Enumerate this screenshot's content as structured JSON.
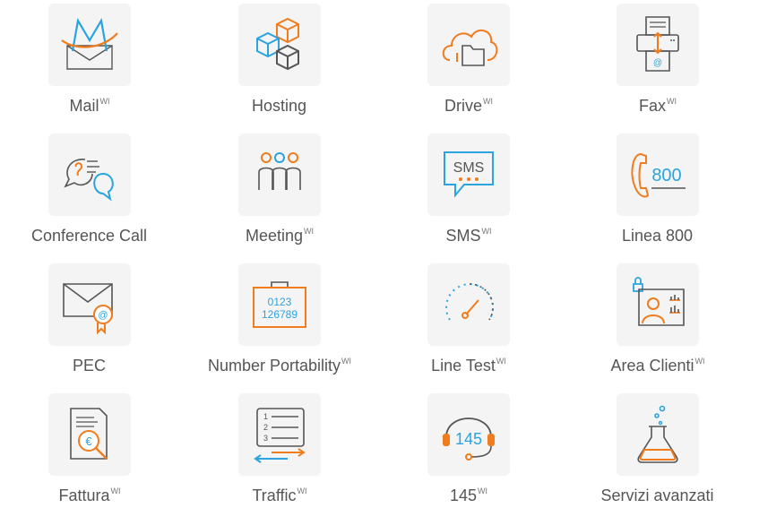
{
  "colors": {
    "orange": "#f07c1d",
    "blue": "#2aa3de",
    "grey": "#555555",
    "tile_bg": "#f4f4f4"
  },
  "tiles": [
    {
      "label": "Mail",
      "sup": "WI",
      "icon": "mail-icon"
    },
    {
      "label": "Hosting",
      "sup": "",
      "icon": "hosting-cubes-icon"
    },
    {
      "label": "Drive",
      "sup": "WI",
      "icon": "cloud-drive-icon"
    },
    {
      "label": "Fax",
      "sup": "WI",
      "icon": "fax-icon"
    },
    {
      "label": "Conference Call",
      "sup": "",
      "icon": "conference-call-icon"
    },
    {
      "label": "Meeting",
      "sup": "WI",
      "icon": "meeting-people-icon"
    },
    {
      "label": "SMS",
      "sup": "WI",
      "icon": "sms-bubble-icon"
    },
    {
      "label": "Linea 800",
      "sup": "",
      "icon": "phone-800-icon"
    },
    {
      "label": "PEC",
      "sup": "",
      "icon": "pec-certified-mail-icon"
    },
    {
      "label": "Number Portability",
      "sup": "WI",
      "icon": "number-portability-icon"
    },
    {
      "label": "Line Test",
      "sup": "WI",
      "icon": "speedometer-icon"
    },
    {
      "label": "Area Clienti",
      "sup": "WI",
      "icon": "customer-area-icon"
    },
    {
      "label": "Fattura",
      "sup": "WI",
      "icon": "invoice-search-icon"
    },
    {
      "label": "Traffic",
      "sup": "WI",
      "icon": "traffic-list-icon"
    },
    {
      "label": "145",
      "sup": "WI",
      "icon": "headset-145-icon"
    },
    {
      "label": "Servizi avanzati",
      "sup": "",
      "icon": "lab-flask-icon"
    }
  ],
  "icon_text": {
    "sms": "SMS",
    "linea800": "800",
    "portability_line1": "0123",
    "portability_line2": "126789",
    "traffic_1": "1",
    "traffic_2": "2",
    "traffic_3": "3",
    "headset": "145",
    "currency": "€",
    "at": "@"
  }
}
